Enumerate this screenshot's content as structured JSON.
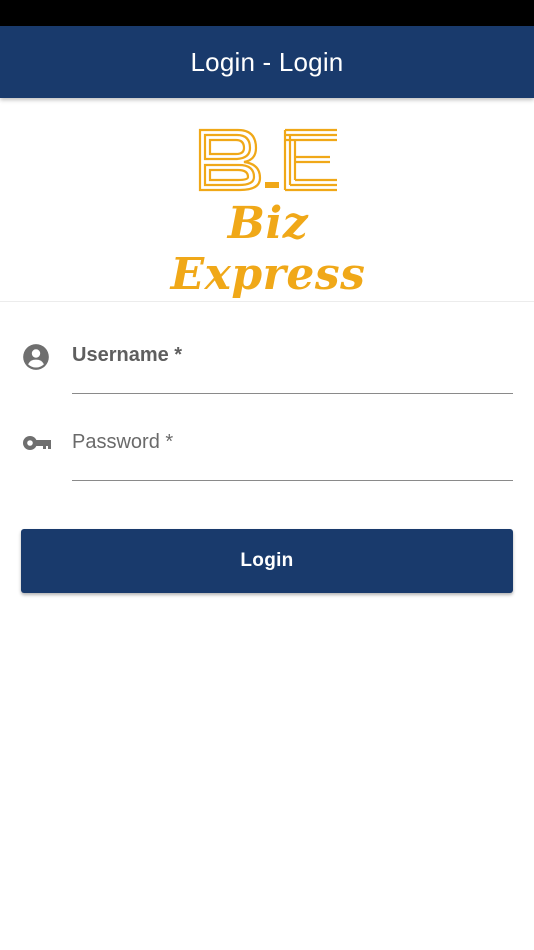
{
  "app_bar": {
    "title": "Login - Login",
    "color": "#193a6c"
  },
  "logo": {
    "monogram_left": "B",
    "monogram_right": "E",
    "brand_name": "Biz Express",
    "color": "#f0a818"
  },
  "form": {
    "username": {
      "label": "Username *",
      "icon": "account-circle-icon",
      "value": ""
    },
    "password": {
      "label": "Password *",
      "icon": "key-icon",
      "value": ""
    },
    "login_label": "Login"
  }
}
